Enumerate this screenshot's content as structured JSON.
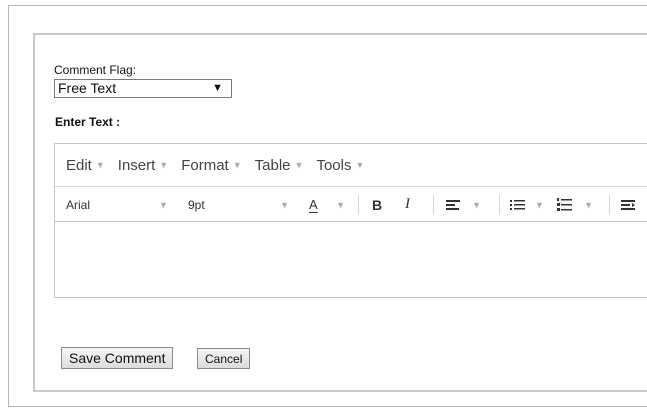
{
  "comment_flag": {
    "label": "Comment Flag:",
    "selected": "Free Text",
    "arrow": "▼"
  },
  "enter_text_label": "Enter Text :",
  "editor": {
    "menu": [
      {
        "label": "Edit"
      },
      {
        "label": "Insert"
      },
      {
        "label": "Format"
      },
      {
        "label": "Table"
      },
      {
        "label": "Tools"
      }
    ],
    "toolbar": {
      "font_family": "Arial",
      "font_size": "9pt",
      "text_color_glyph": "A",
      "bold_glyph": "B",
      "italic_glyph": "I"
    },
    "content": ""
  },
  "buttons": {
    "save": "Save Comment",
    "cancel": "Cancel"
  }
}
